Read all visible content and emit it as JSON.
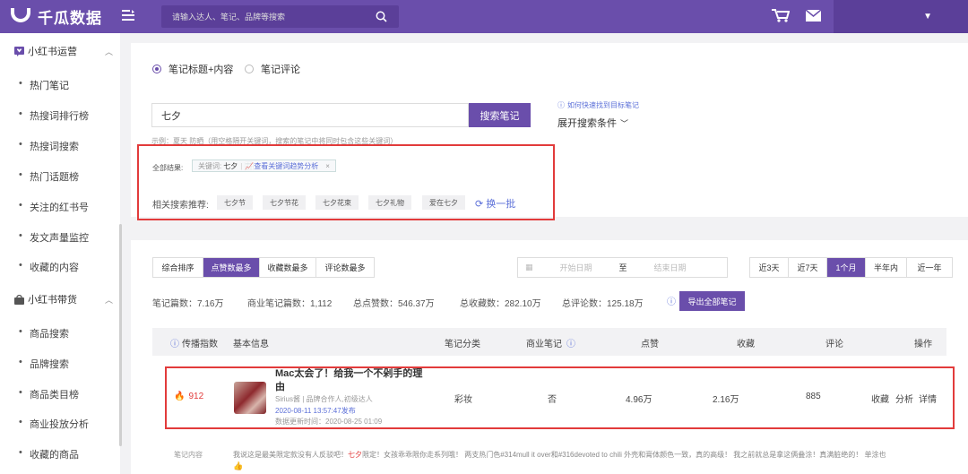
{
  "app": {
    "name": "千瓜数据"
  },
  "search": {
    "placeholder": "请输入达人、笔记、品牌等搜索"
  },
  "sidebar": {
    "group1": {
      "label": "小红书运营"
    },
    "group1_items": [
      "热门笔记",
      "热搜词排行榜",
      "热搜词搜索",
      "热门话题榜",
      "关注的红书号",
      "发文声量监控",
      "收藏的内容"
    ],
    "group2": {
      "label": "小红书带货"
    },
    "group2_items": [
      "商品搜索",
      "品牌搜索",
      "商品类目榜",
      "商业投放分析",
      "收藏的商品"
    ]
  },
  "filter": {
    "radio1": "笔记标题+内容",
    "radio2": "笔记评论",
    "keyword": "七夕",
    "search_button": "搜索笔记",
    "help_link": "如何快速找到目标笔记",
    "expand": "展开搜索条件",
    "example": "示例：夏天 防晒（用空格隔开关键词，搜索的笔记中将同时包含这些关键词）",
    "all_results_label": "全部结果:",
    "tag_keyword_label": "关键词:",
    "tag_keyword_value": "七夕",
    "tag_trend_link": "查看关键词趋势分析",
    "related_label": "相关搜索推荐:",
    "related": [
      "七夕节",
      "七夕节花",
      "七夕花束",
      "七夕礼物",
      "爱在七夕"
    ],
    "refresh": "换一批"
  },
  "sort": {
    "tabs": [
      "综合排序",
      "点赞数最多",
      "收藏数最多",
      "评论数最多"
    ],
    "active": 1,
    "start_placeholder": "开始日期",
    "to": "至",
    "end_placeholder": "结束日期",
    "ranges": [
      "近3天",
      "近7天",
      "1个月",
      "半年内",
      "近一年"
    ],
    "active_range": 2
  },
  "stats": {
    "notes": "笔记篇数：7.16万",
    "business": "商业笔记篇数：1,112",
    "likes": "总点赞数：546.37万",
    "collects": "总收藏数：282.10万",
    "comments": "总评论数：125.18万",
    "export": "导出全部笔记"
  },
  "table": {
    "headers": [
      "传播指数",
      "基本信息",
      "笔记分类",
      "商业笔记",
      "点赞",
      "收藏",
      "评论",
      "操作"
    ],
    "row": {
      "index": "912",
      "title": "Mac太会了！给我一个不剁手的理由",
      "author": "Sirius酱 | 品牌合作人,初级达人",
      "published": "2020-08-11 13:57:47发布",
      "updated": "数据更新时间：2020-08-25 01:09",
      "category": "彩妆",
      "business": "否",
      "likes": "4.96万",
      "collects": "2.16万",
      "comments": "885",
      "actions": [
        "收藏",
        "分析",
        "详情"
      ]
    },
    "content_label": "笔记内容",
    "content_pre": "我说这是最美限定款没有人反驳吧！",
    "content_hl": "七夕",
    "content_post": "限定！女孩乖乖限你走系列哦！ 两支热门色#314mull it over和#316devoted to chili 外壳和膏体颜色一致，真的高级！ 我之前就总是拿这俩叠涂！真满脏绝的！ 单涂也"
  },
  "colors": {
    "brand": "#6a4eab",
    "highlight": "#e23b3b",
    "link": "#5b6fd8"
  }
}
